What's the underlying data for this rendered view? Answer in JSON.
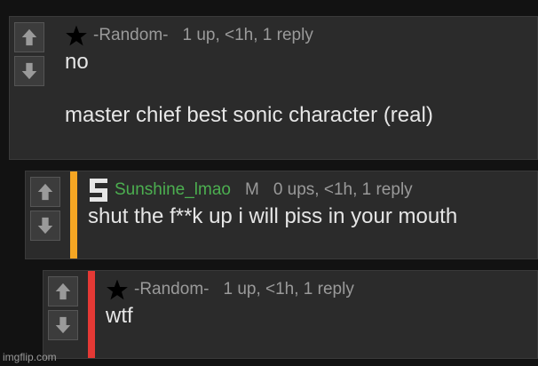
{
  "comments": [
    {
      "username": "-Random-",
      "meta": "1 up, <1h, 1 reply",
      "lines": [
        "no",
        "",
        "master chief best sonic character (real)"
      ]
    },
    {
      "username": "Sunshine_lmao",
      "mod_badge": "M",
      "meta": "0 ups, <1h, 1 reply",
      "lines": [
        "shut the f**k up i will piss in your mouth"
      ],
      "accent_color": "#f5a623"
    },
    {
      "username": "-Random-",
      "meta": "1 up, <1h, 1 reply",
      "lines": [
        "wtf"
      ],
      "accent_color": "#e53935"
    }
  ],
  "icons": {
    "upvote": "arrow-up-icon",
    "downvote": "arrow-down-icon",
    "star": "star-icon",
    "avatar_s": "s-logo-icon"
  },
  "colors": {
    "background": "#121212",
    "panel": "#2b2b2b",
    "username_green": "#4caf50"
  },
  "watermark": "imgflip.com"
}
